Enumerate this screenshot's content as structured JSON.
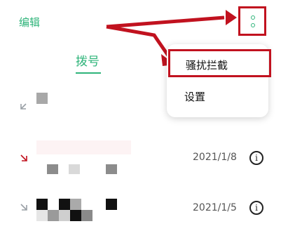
{
  "header": {
    "edit_label": "编辑",
    "more_icon": "more-vertical-icon"
  },
  "tabs": [
    {
      "label": "拨号",
      "active": true
    }
  ],
  "menu": {
    "items": [
      {
        "label": "骚扰拦截",
        "highlighted": true
      },
      {
        "label": "设置",
        "highlighted": false
      }
    ]
  },
  "calls": [
    {
      "type": "outgoing",
      "icon": "outgoing-call-arrow-icon",
      "date": ""
    },
    {
      "type": "missed",
      "icon": "incoming-call-arrow-icon",
      "date": "2021/1/8"
    },
    {
      "type": "incoming",
      "icon": "incoming-call-arrow-icon",
      "date": "2021/1/5"
    }
  ],
  "colors": {
    "accent": "#2fb47a",
    "highlight": "#c1121f",
    "missed": "#c1121f"
  }
}
